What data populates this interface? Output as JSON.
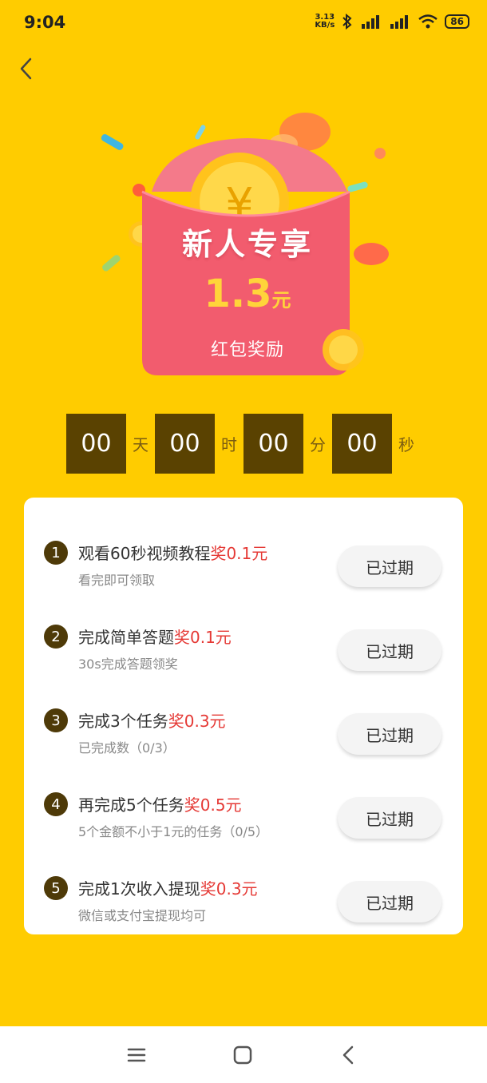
{
  "status_bar": {
    "time": "9:04",
    "net_speed_value": "3.13",
    "net_speed_unit": "KB/s",
    "battery": "86"
  },
  "hero": {
    "title": "新人专享",
    "amount": "1.3",
    "amount_unit": "元",
    "subtitle": "红包奖励"
  },
  "countdown": {
    "days": "00",
    "days_label": "天",
    "hours": "00",
    "hours_label": "时",
    "minutes": "00",
    "minutes_label": "分",
    "seconds": "00",
    "seconds_label": "秒"
  },
  "tasks": [
    {
      "num": "1",
      "title": "观看60秒视频教程",
      "reward": "奖0.1元",
      "desc": "看完即可领取",
      "button": "已过期"
    },
    {
      "num": "2",
      "title": "完成简单答题",
      "reward": "奖0.1元",
      "desc": "30s完成答题领奖",
      "button": "已过期"
    },
    {
      "num": "3",
      "title": "完成3个任务",
      "reward": "奖0.3元",
      "desc": "已完成数（0/3）",
      "button": "已过期"
    },
    {
      "num": "4",
      "title": "再完成5个任务",
      "reward": "奖0.5元",
      "desc": "5个金额不小于1元的任务（0/5）",
      "button": "已过期"
    },
    {
      "num": "5",
      "title": "完成1次收入提现",
      "reward": "奖0.3元",
      "desc": "微信或支付宝提现均可",
      "button": "已过期"
    }
  ],
  "icons": {
    "back": "chevron-left-icon",
    "menu": "menu-icon",
    "home": "home-square-icon",
    "nav_back": "nav-back-icon"
  },
  "colors": {
    "background": "#FFCC00",
    "countdown_box": "#5A4201",
    "reward": "#E53935",
    "envelope": "#F25C6E"
  }
}
